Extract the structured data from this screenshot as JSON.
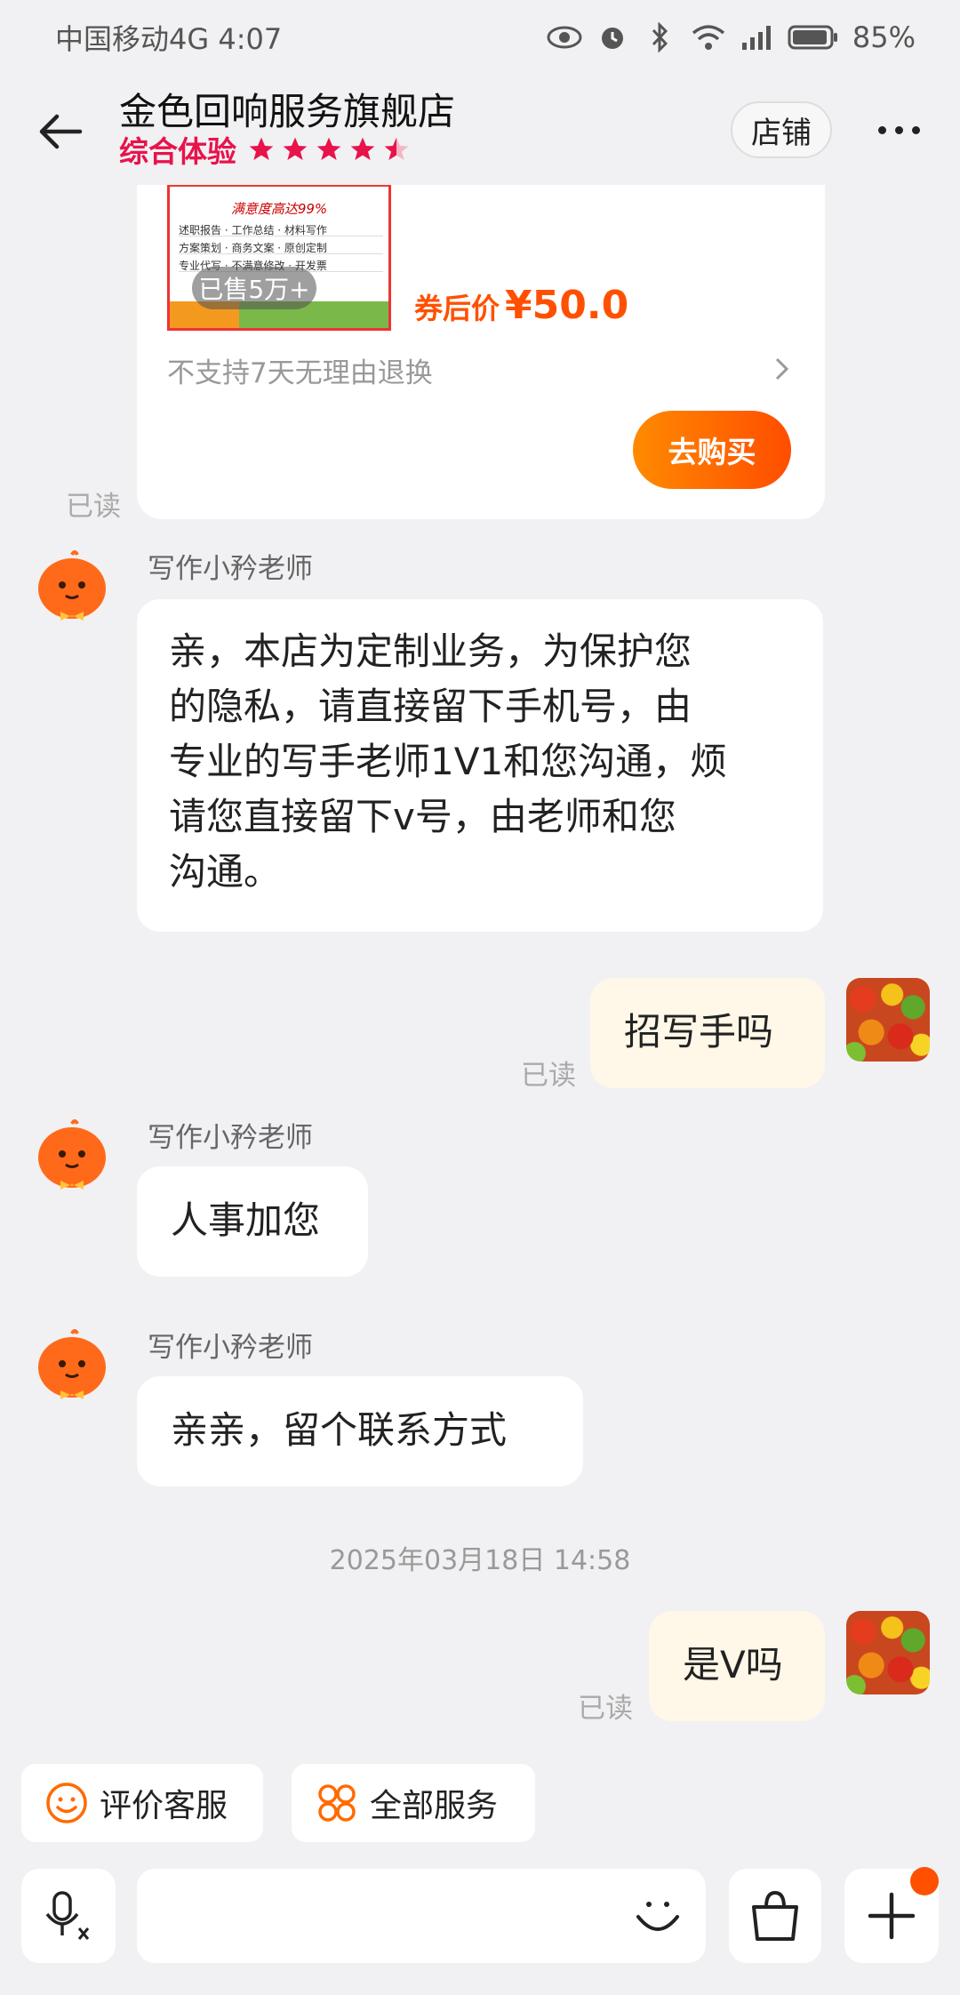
{
  "status_bar": {
    "carrier_time": "中国移动4G 4:07",
    "battery": "85%"
  },
  "header": {
    "shop_name": "金色回响服务旗舰店",
    "rating_label": "综合体验",
    "stars": 4.5,
    "store_button": "店铺"
  },
  "product_card": {
    "sold": "已售5万+",
    "thumb_subtitle": "满意度高达99%",
    "thumb_items": [
      "述职报告 · 工作总结 · 材料写作",
      "方案策划 · 商务文案 · 原创定制",
      "专业代写 · 不满意修改 · 开发票"
    ],
    "price_label": "券后价",
    "price": "¥50.0",
    "return_policy": "不支持7天无理由退换",
    "buy_button": "去购买"
  },
  "read_label": "已读",
  "messages": [
    {
      "sender": "写作小矜老师",
      "text": "亲，本店为定制业务，为保护您的隐私，请直接留下手机号，由专业的写手老师1V1和您沟通，烦请您直接留下v号，由老师和您沟通。",
      "lines": [
        "亲，本店为定制业务，为保护您",
        "的隐私，请直接留下手机号，由",
        "专业的写手老师1V1和您沟通，烦",
        "请您直接留下v号，由老师和您",
        "沟通。"
      ]
    },
    {
      "sender": "me",
      "text": "招写手吗"
    },
    {
      "sender": "写作小矜老师",
      "text": "人事加您"
    },
    {
      "sender": "写作小矜老师",
      "text": "亲亲，留个联系方式"
    },
    {
      "sender": "me",
      "text": "是V吗"
    }
  ],
  "timestamp": "2025年03月18日 14:58",
  "quick_actions": [
    "评价客服",
    "全部服务"
  ],
  "icons": {
    "back": "arrow-left-icon",
    "more": "more-dots-icon",
    "voice": "microphone-translate-icon",
    "emoji": "smile-icon",
    "bag": "shopping-bag-icon",
    "plus": "plus-icon"
  },
  "colors": {
    "accent": "#ff5000",
    "rating": "#e8134b",
    "bot_avatar": "#ff6a1a"
  }
}
